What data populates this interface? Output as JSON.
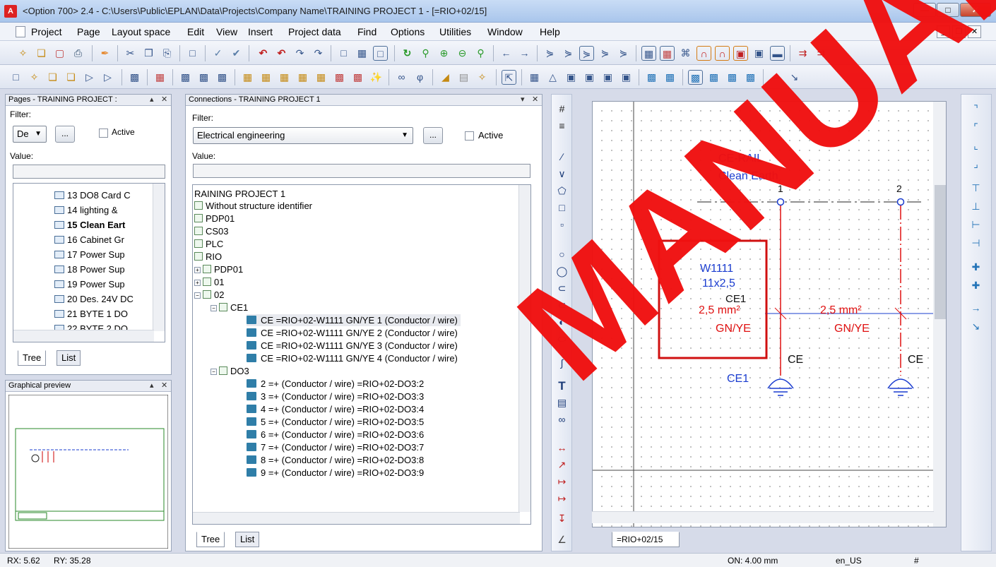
{
  "window": {
    "title": "<Option 700> 2.4 - C:\\Users\\Public\\EPLAN\\Data\\Projects\\Company Name\\TRAINING PROJECT 1 - [=RIO+02/15]"
  },
  "menu": [
    "Project",
    "Page",
    "Layout space",
    "Edit",
    "View",
    "Insert",
    "Project data",
    "Find",
    "Options",
    "Utilities",
    "Window",
    "Help"
  ],
  "pages_panel": {
    "title": "Pages - TRAINING PROJECT :",
    "filter_label": "Filter:",
    "filter_value": "De",
    "dots_label": "...",
    "active_label": "Active",
    "value_label": "Value:",
    "items": [
      "13 DO8 Card C",
      "14 lighting &",
      "15 Clean Eart",
      "16 Cabinet Gr",
      "17 Power Sup",
      "18 Power Sup",
      "19 Power Sup",
      "20 Des. 24V DC",
      "21 BYTE 1 DO",
      "22 BYTE 2 DO"
    ],
    "tabs": [
      "Tree",
      "List"
    ]
  },
  "preview_panel": {
    "title": "Graphical preview"
  },
  "connections_panel": {
    "title": "Connections - TRAINING PROJECT 1",
    "filter_label": "Filter:",
    "filter_value": "Electrical engineering",
    "dots_label": "...",
    "active_label": "Active",
    "value_label": "Value:",
    "root": "RAINING PROJECT 1",
    "items": [
      {
        "label": "Without structure identifier",
        "type": "y"
      },
      {
        "label": "PDP01",
        "type": "struct"
      },
      {
        "label": "CS03",
        "type": "struct"
      },
      {
        "label": "PLC",
        "type": "struct"
      },
      {
        "label": "RIO",
        "type": "struct"
      },
      {
        "label": "PDP01",
        "type": "plus"
      },
      {
        "label": "01",
        "type": "plus"
      },
      {
        "label": "02",
        "type": "plus"
      },
      {
        "label": "CE1",
        "type": "xy"
      },
      {
        "label": "CE =RIO+02-W1111 GN/YE 1  (Conductor / wire)",
        "type": "conn"
      },
      {
        "label": "CE =RIO+02-W1111 GN/YE 2  (Conductor / wire)",
        "type": "conn"
      },
      {
        "label": "CE =RIO+02-W1111 GN/YE 3  (Conductor / wire)",
        "type": "conn"
      },
      {
        "label": "CE =RIO+02-W1111 GN/YE 4  (Conductor / wire)",
        "type": "conn"
      },
      {
        "label": "DO3",
        "type": "xy"
      },
      {
        "label": "2 =+  (Conductor / wire) =RIO+02-DO3:2",
        "type": "conn"
      },
      {
        "label": "3 =+  (Conductor / wire) =RIO+02-DO3:3",
        "type": "conn"
      },
      {
        "label": "4 =+  (Conductor / wire) =RIO+02-DO3:4",
        "type": "conn"
      },
      {
        "label": "5 =+  (Conductor / wire) =RIO+02-DO3:5",
        "type": "conn"
      },
      {
        "label": "6 =+  (Conductor / wire) =RIO+02-DO3:6",
        "type": "conn"
      },
      {
        "label": "7 =+  (Conductor / wire) =RIO+02-DO3:7",
        "type": "conn"
      },
      {
        "label": "8 =+  (Conductor / wire) =RIO+02-DO3:8",
        "type": "conn"
      },
      {
        "label": "9 =+  (Conductor / wire) =RIO+02-DO3:9",
        "type": "conn"
      }
    ],
    "tabs": [
      "Tree",
      "List"
    ]
  },
  "canvas": {
    "rail_title": "CE-RAIL",
    "rail_subtitle": "Clean Earth",
    "col1": "1",
    "col2": "2",
    "cable_name": "W1111",
    "cable_spec": "11x2,5",
    "cable_core": "CE1",
    "cs_left": "2,5 mm²",
    "cs_right": "2,5 mm²",
    "color_left": "GN/YE",
    "color_right": "GN/YE",
    "term1": "CE",
    "term2": "CE",
    "term_lbl": "CE1",
    "page_tab": "=RIO+02/15"
  },
  "status": {
    "rx": "RX: 5.62",
    "ry": "RY: 35.28",
    "grid": "ON: 4.00 mm",
    "locale": "en_US",
    "hash": "#"
  },
  "watermark": "MANUAL"
}
